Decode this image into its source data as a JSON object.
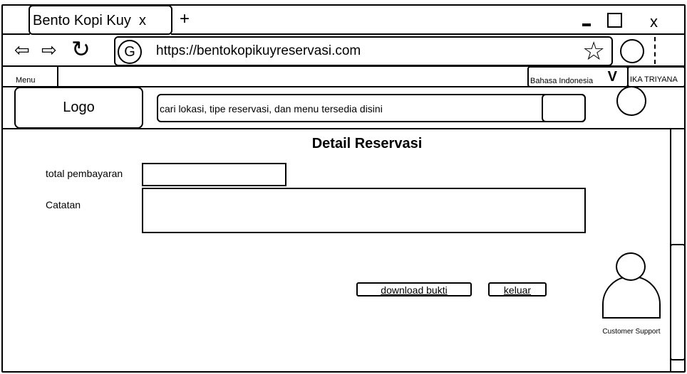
{
  "browser": {
    "tab_title": "Bento Kopi Kuy",
    "tab_close": "x",
    "new_tab": "+",
    "window_close": "x",
    "url_icon": "G",
    "url": "https://bentokopikuyreservasi.com"
  },
  "navbar": {
    "menu": "Menu",
    "language": "Bahasa Indonesia",
    "language_toggle": "V",
    "user_name": "IKA TRIYANA"
  },
  "header": {
    "logo": "Logo",
    "search_placeholder": "cari lokasi, tipe reservasi, dan menu tersedia disini"
  },
  "main": {
    "title": "Detail Reservasi",
    "total_label": "total pembayaran",
    "total_value": "",
    "notes_label": "Catatan",
    "notes_value": "",
    "download_button": "download bukti",
    "exit_button": "keluar"
  },
  "support": {
    "label": "Customer Support"
  },
  "icons": [
    "back-arrow-icon",
    "forward-arrow-icon",
    "reload-icon",
    "star-icon",
    "profile-icon",
    "user-avatar-icon",
    "customer-support-icon"
  ]
}
